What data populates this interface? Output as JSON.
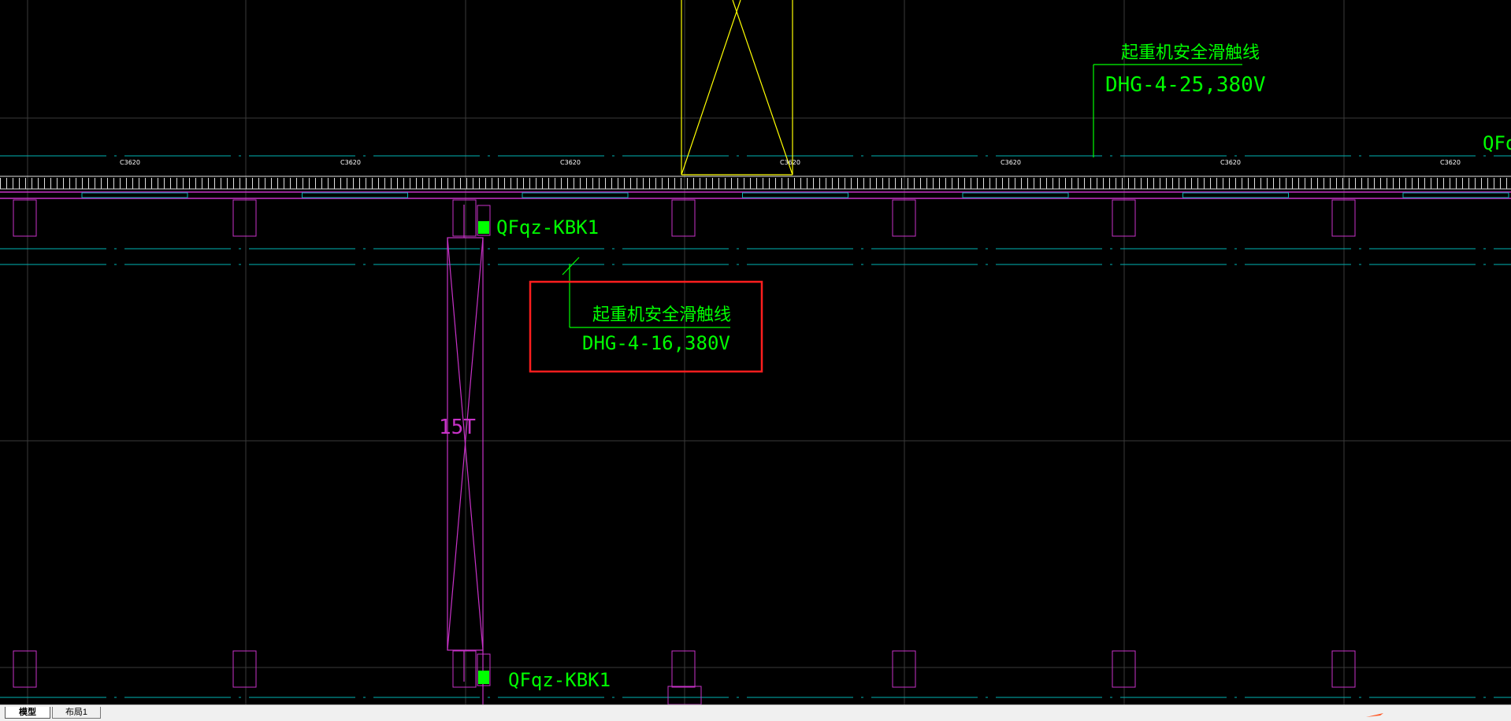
{
  "drawing": {
    "background_color": "#000000",
    "colors": {
      "grid": "#3a3a3a",
      "axis_dashed": "#00b4b4",
      "crane": "#c832c8",
      "label_green": "#00ff00",
      "hoist_yellow": "#ffff00",
      "highlight_red": "#ff1e1e",
      "rail": "#e0e0e0"
    },
    "rail_dimension_label": "C3620",
    "callout_top_right": {
      "title": "起重机安全滑触线",
      "spec": "DHG-4-25,380V"
    },
    "callout_highlighted": {
      "title": "起重机安全滑触线",
      "spec": "DHG-4-16,380V"
    },
    "switch_label_upper": "QFqz-KBK1",
    "switch_label_lower": "QFqz-KBK1",
    "switch_label_edge": "QFq",
    "crane_capacity": "15T"
  },
  "tabs": {
    "model": "模型",
    "layout1": "布局1"
  },
  "icons": {
    "cursor": "arrow-cursor-icon"
  }
}
